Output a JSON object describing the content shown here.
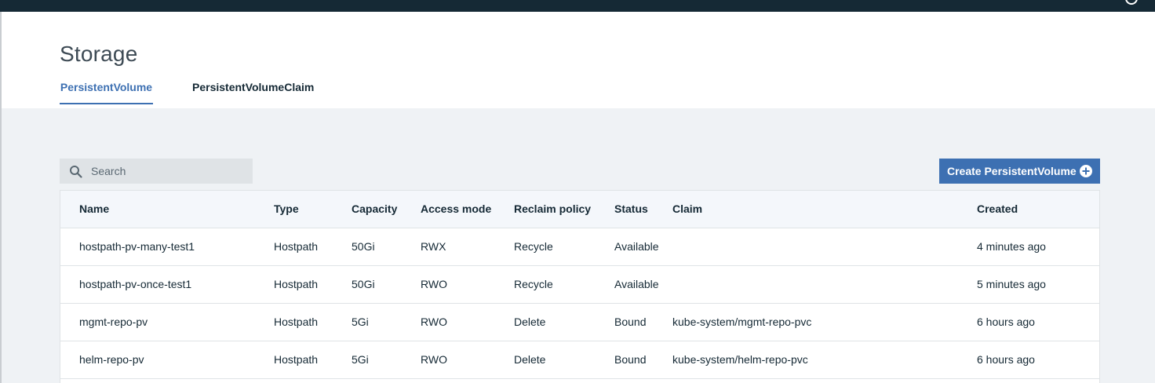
{
  "page": {
    "title": "Storage"
  },
  "tabs": [
    {
      "label": "PersistentVolume",
      "active": true
    },
    {
      "label": "PersistentVolumeClaim",
      "active": false
    }
  ],
  "search": {
    "placeholder": "Search",
    "value": ""
  },
  "toolbar": {
    "create_label": "Create PersistentVolume"
  },
  "table": {
    "columns": [
      "Name",
      "Type",
      "Capacity",
      "Access mode",
      "Reclaim policy",
      "Status",
      "Claim",
      "Created"
    ],
    "rows": [
      {
        "name": "hostpath-pv-many-test1",
        "type": "Hostpath",
        "capacity": "50Gi",
        "access_mode": "RWX",
        "reclaim_policy": "Recycle",
        "status": "Available",
        "claim": "",
        "created": "4 minutes ago"
      },
      {
        "name": "hostpath-pv-once-test1",
        "type": "Hostpath",
        "capacity": "50Gi",
        "access_mode": "RWO",
        "reclaim_policy": "Recycle",
        "status": "Available",
        "claim": "",
        "created": "5 minutes ago"
      },
      {
        "name": "mgmt-repo-pv",
        "type": "Hostpath",
        "capacity": "5Gi",
        "access_mode": "RWO",
        "reclaim_policy": "Delete",
        "status": "Bound",
        "claim": "kube-system/mgmt-repo-pvc",
        "created": "6 hours ago"
      },
      {
        "name": "helm-repo-pv",
        "type": "Hostpath",
        "capacity": "5Gi",
        "access_mode": "RWO",
        "reclaim_policy": "Delete",
        "status": "Bound",
        "claim": "kube-system/helm-repo-pvc",
        "created": "6 hours ago"
      }
    ]
  },
  "icons": {
    "search": "search-icon",
    "add": "add-circle-icon",
    "user": "user-icon"
  },
  "colors": {
    "topbar": "#152935",
    "accent": "#3d70b2",
    "content_bg": "#eff2f5",
    "search_bg": "#dfe3e6",
    "table_header_bg": "#f4f7fb"
  }
}
